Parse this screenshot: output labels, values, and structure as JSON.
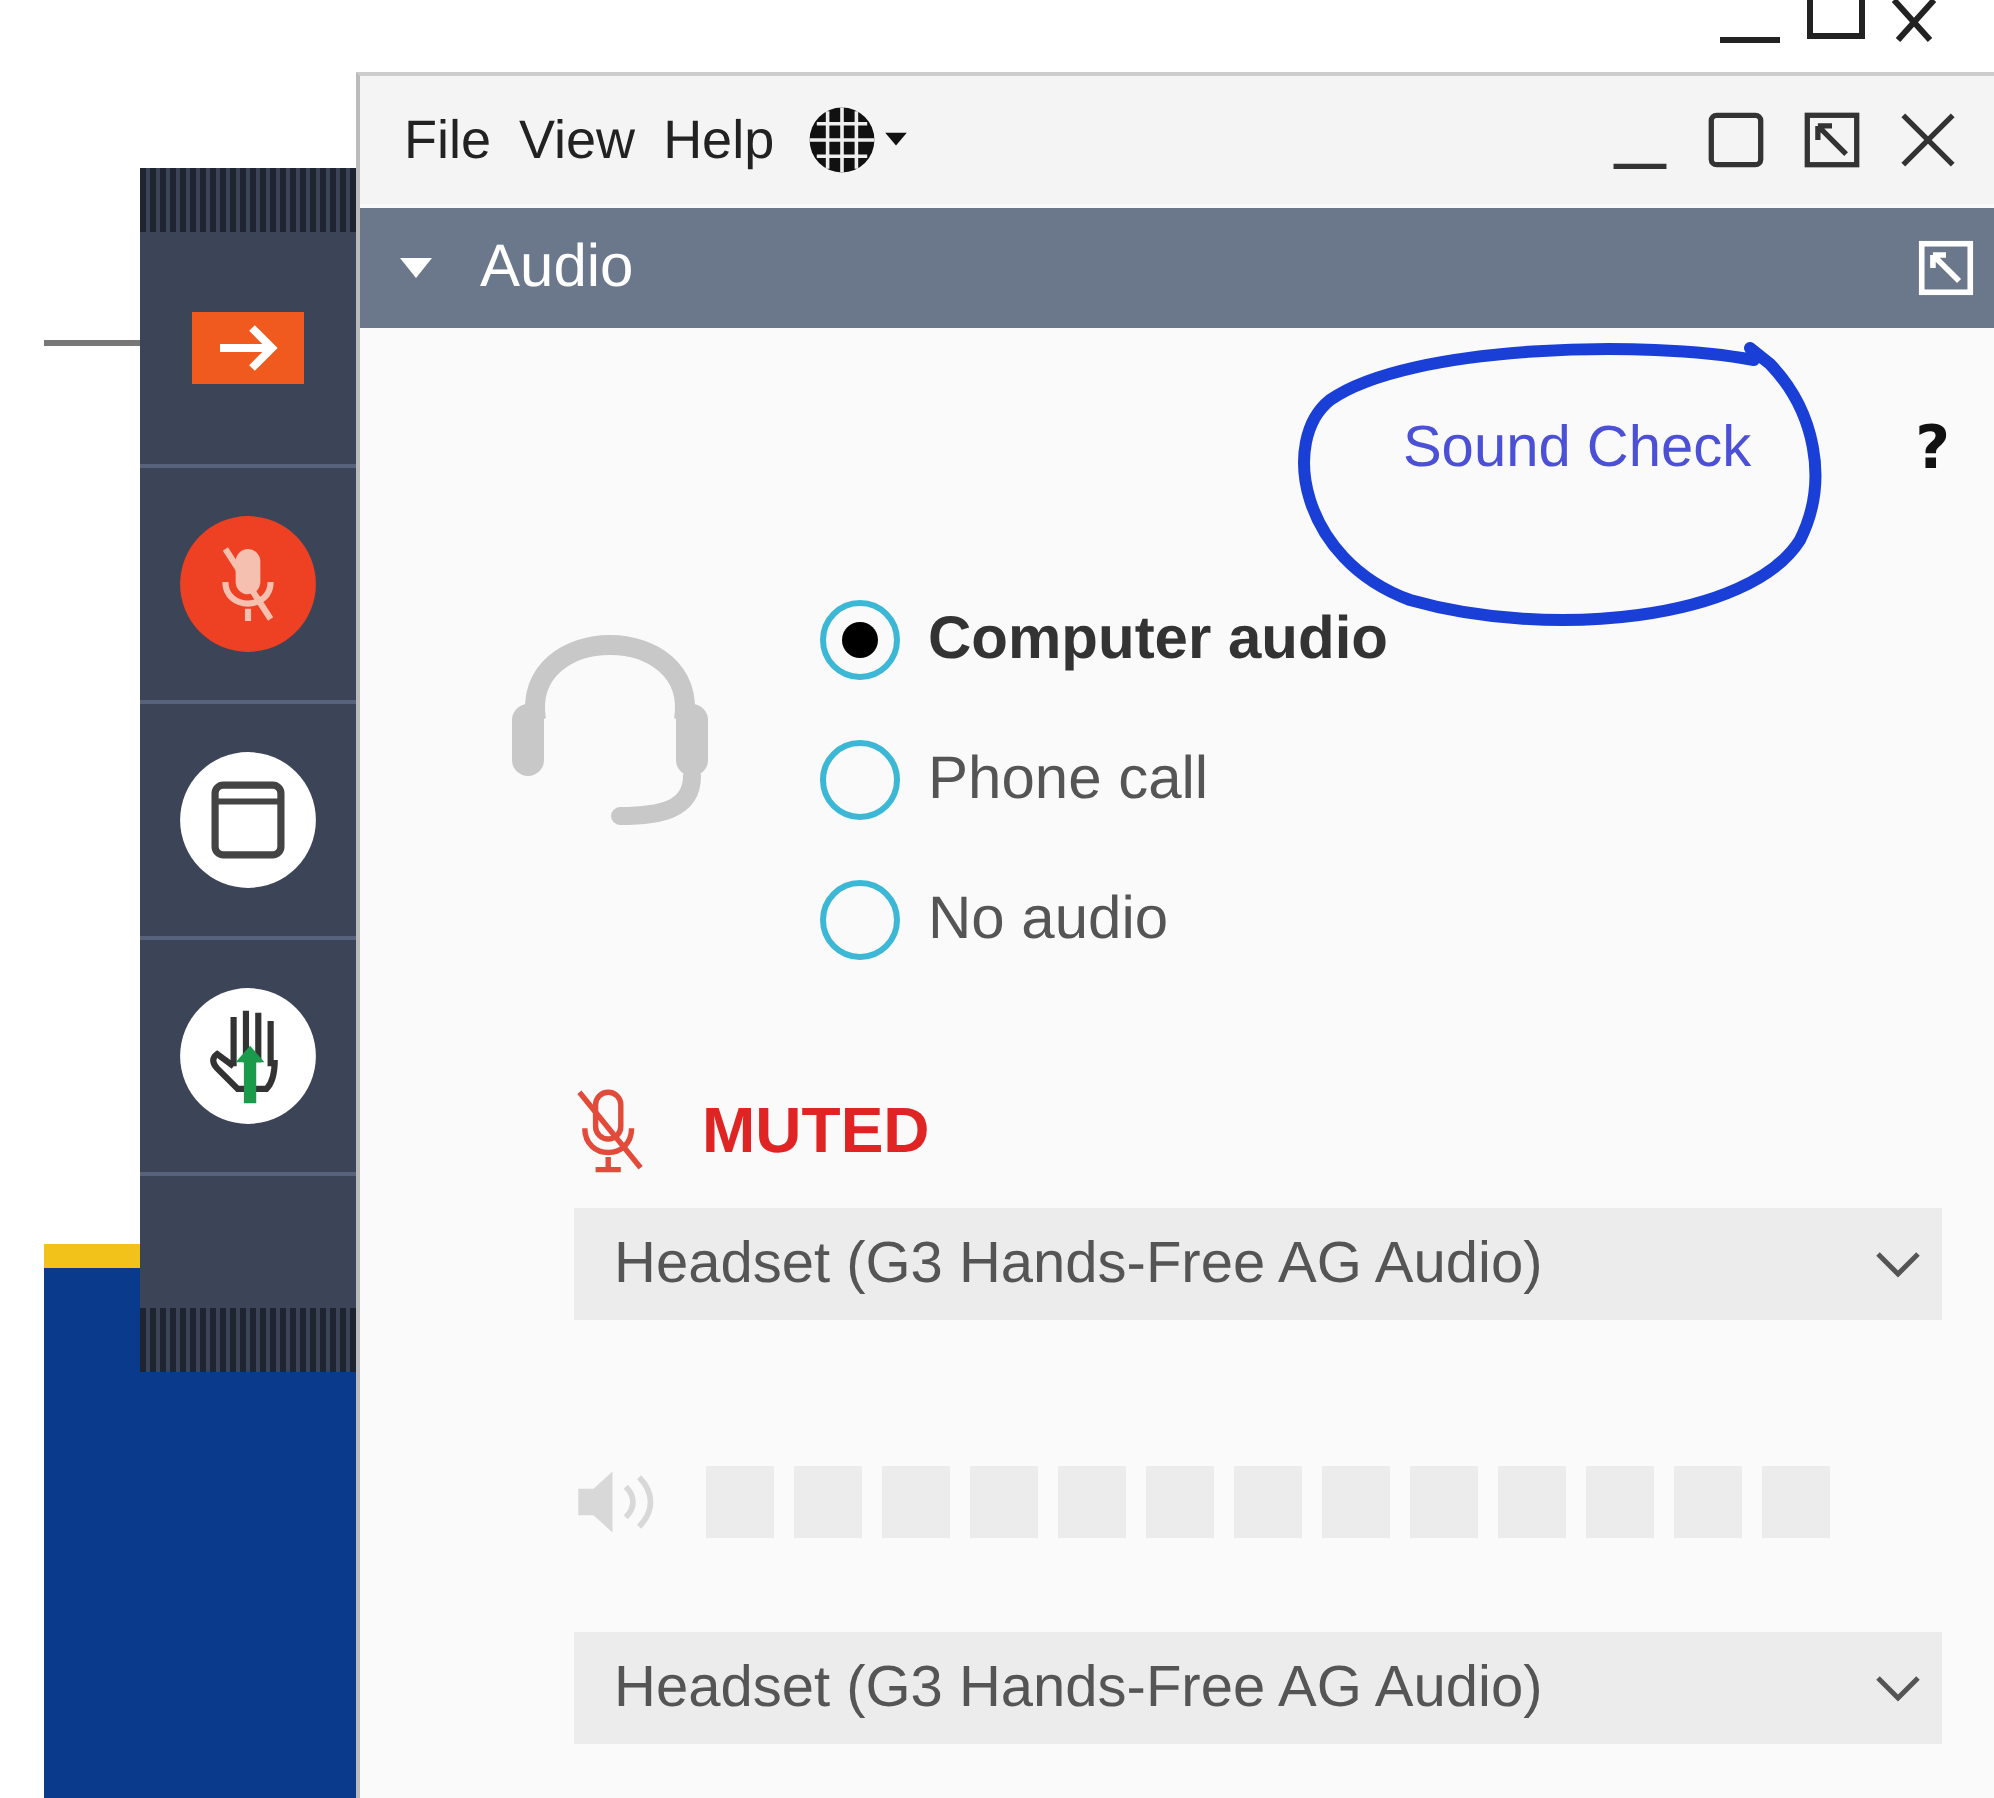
{
  "toolbar": {
    "items": [
      {
        "kind": "exit"
      },
      {
        "kind": "mic",
        "muted": true
      },
      {
        "kind": "screen"
      },
      {
        "kind": "hand"
      }
    ]
  },
  "menu": [
    "File",
    "View",
    "Help"
  ],
  "panel": {
    "title": "Audio",
    "expanded": true
  },
  "sound_check": "Sound Check",
  "help": "?",
  "audio_options": [
    {
      "label": "Computer audio",
      "selected": true
    },
    {
      "label": "Phone call",
      "selected": false
    },
    {
      "label": "No audio",
      "selected": false
    }
  ],
  "mic_status": {
    "label": "MUTED",
    "muted": true
  },
  "microphone_select": {
    "value": "Headset (G3 Hands-Free AG Audio)"
  },
  "speaker_meter": {
    "level": 0
  },
  "speaker_select": {
    "value": "Headset (G3 Hands-Free AG Audio)"
  }
}
